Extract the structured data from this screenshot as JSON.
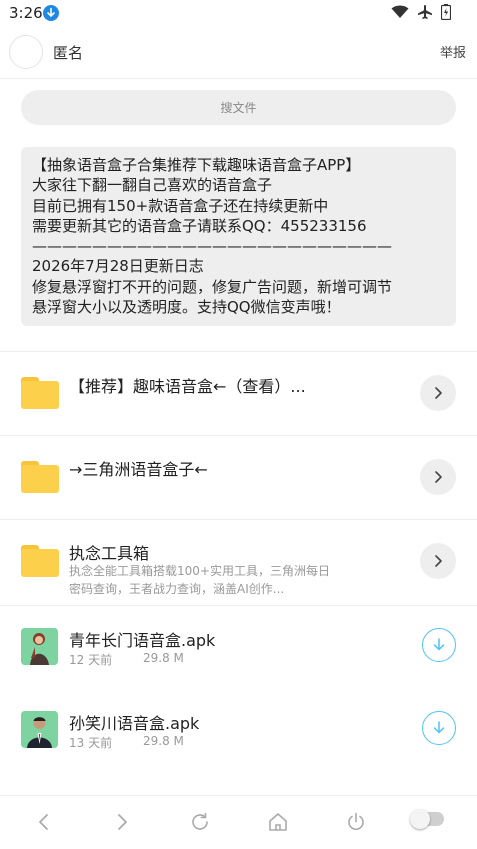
{
  "status_bar": {
    "time": "3:26"
  },
  "header": {
    "user_name": "匿名",
    "report_label": "举报"
  },
  "search": {
    "placeholder": "搜文件"
  },
  "notice": {
    "lines": [
      "【抽象语音盒子合集推荐下载趣味语音盒子APP】",
      "大家往下翻一翻自己喜欢的语音盒子",
      "目前已拥有150+款语音盒子还在持续更新中",
      "需要更新其它的语音盒子请联系QQ：455233156",
      "————————————————————————",
      "2026年7月28日更新日志",
      "修复悬浮窗打不开的问题，修复广告问题，新增可调节",
      "悬浮窗大小以及透明度。支持QQ微信变声哦！"
    ]
  },
  "folders": [
    {
      "title": "【推荐】趣味语音盒←（查看）..."
    },
    {
      "title": "→三角洲语音盒子←"
    },
    {
      "title": "执念工具箱",
      "desc": "执念全能工具箱搭载100+实用工具，三角洲每日密码查询，王者战力查询，涵盖AI创作..."
    }
  ],
  "files": [
    {
      "name": "青年长门语音盒.apk",
      "date": "12 天前",
      "size": "29.8 M"
    },
    {
      "name": "孙笑川语音盒.apk",
      "date": "13 天前",
      "size": "29.8 M"
    }
  ],
  "colors": {
    "folder": "#fcd04b",
    "download_accent": "#4fc3f7",
    "divider": "#eeeeee"
  }
}
